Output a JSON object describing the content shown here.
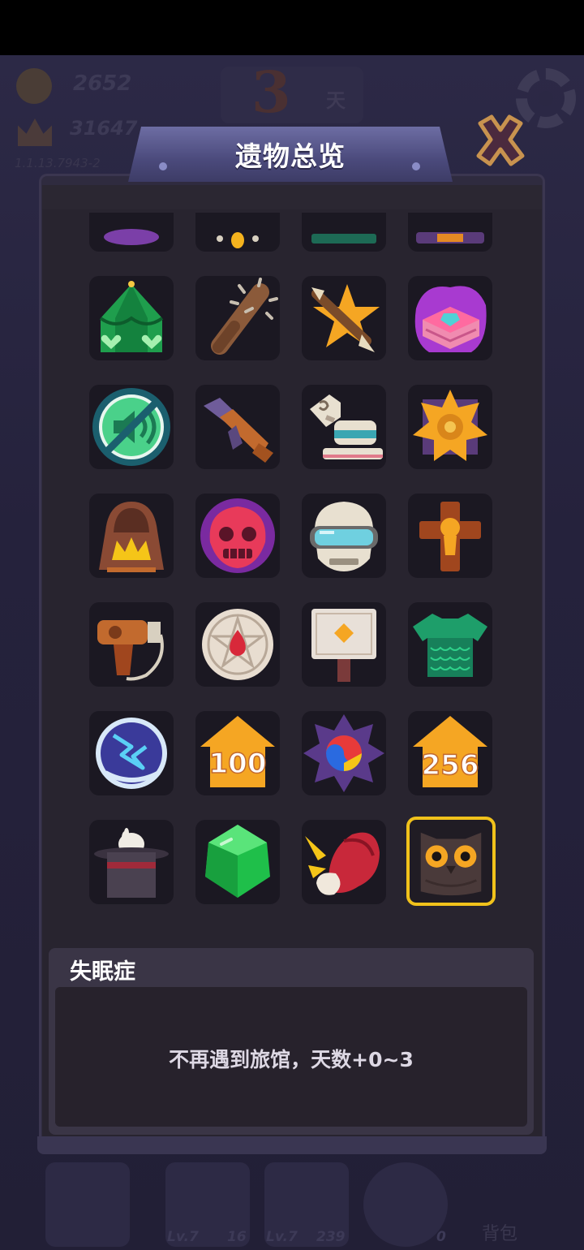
{
  "hud": {
    "coins": "2652",
    "crowns": "31647",
    "version": "1.1.13.7943-2",
    "day_number": "3",
    "day_label": "天"
  },
  "dialog": {
    "title": "遗物总览",
    "close_icon": "close-x-icon"
  },
  "relics": {
    "rows": [
      [
        {
          "icon": "purple-relic-partial-icon"
        },
        {
          "icon": "yellow-relic-partial-icon"
        },
        {
          "icon": "green-relic-partial-icon"
        },
        {
          "icon": "orange-relic-partial-icon"
        }
      ],
      [
        {
          "icon": "green-tent-icon"
        },
        {
          "icon": "spiked-club-icon"
        },
        {
          "icon": "star-arrow-icon"
        },
        {
          "icon": "cursed-book-icon"
        }
      ],
      [
        {
          "icon": "mute-icon"
        },
        {
          "icon": "rifle-icon"
        },
        {
          "icon": "toy-horse-icon"
        },
        {
          "icon": "sheriff-badge-icon"
        }
      ],
      [
        {
          "icon": "hooded-campfire-icon"
        },
        {
          "icon": "red-ghost-skull-icon"
        },
        {
          "icon": "skull-goggles-icon"
        },
        {
          "icon": "golden-cross-icon"
        }
      ],
      [
        {
          "icon": "hair-dryer-icon"
        },
        {
          "icon": "pentagram-disc-icon"
        },
        {
          "icon": "signboard-icon"
        },
        {
          "icon": "scale-armor-icon"
        }
      ],
      [
        {
          "icon": "lightning-orb-icon"
        },
        {
          "icon": "house-100-icon",
          "label": "100"
        },
        {
          "icon": "taiji-star-icon"
        },
        {
          "icon": "house-256-icon",
          "label": "256"
        }
      ],
      [
        {
          "icon": "magic-hat-rabbit-icon"
        },
        {
          "icon": "green-gem-icon"
        },
        {
          "icon": "meat-bone-icon"
        },
        {
          "icon": "owl-icon",
          "selected": true
        }
      ]
    ]
  },
  "selected_relic": {
    "name": "失眠症",
    "description": "不再遇到旅馆，天数+0~3"
  },
  "bottom": {
    "slots": [
      {
        "lv": "",
        "count": ""
      },
      {
        "lv": "Lv.7",
        "count": "16"
      },
      {
        "lv": "Lv.7",
        "count": "239"
      },
      {
        "lv": "",
        "count": "0"
      }
    ],
    "bag_label": "背包"
  },
  "colors": {
    "accent_selected": "#f1c21b",
    "tile_bg": "#1b1822",
    "title_bar": "#4b4a7c"
  }
}
